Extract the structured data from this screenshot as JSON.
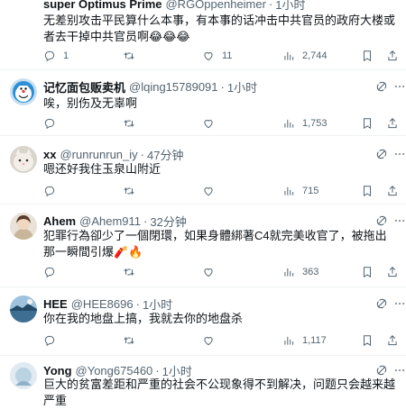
{
  "tweets": [
    {
      "name": "super Optimus Prime",
      "handle": "@RGOppenheimer",
      "time": "1小时",
      "text": "无差别攻击平民算什么本事，有本事的话冲击中共官员的政府大楼或者去干掉中共官员啊😂😂😂",
      "replies": "1",
      "retweets": "",
      "likes": "11",
      "views": "2,744"
    },
    {
      "name": "记忆面包贩卖机",
      "handle": "@lqing15789091",
      "time": "1小时",
      "text": "唉，别伤及无辜啊",
      "replies": "",
      "retweets": "",
      "likes": "",
      "views": "1,753"
    },
    {
      "name": "xx",
      "handle": "@runrunrun_iy",
      "time": "47分钟",
      "text": "嗯还好我住玉泉山附近",
      "replies": "",
      "retweets": "",
      "likes": "",
      "views": "715"
    },
    {
      "name": "Ahem",
      "handle": "@Ahem911",
      "time": "32分钟",
      "text": "犯罪行為卻少了一個閉環，如果身體綁著C4就完美收官了，被拖出那一瞬間引爆🧨🔥",
      "replies": "",
      "retweets": "",
      "likes": "",
      "views": "363"
    },
    {
      "name": "HEE",
      "handle": "@HEE8696",
      "time": "1小时",
      "text": "你在我的地盘上搞，我就去你的地盘杀",
      "replies": "",
      "retweets": "",
      "likes": "",
      "views": "1,117"
    },
    {
      "name": "Yong",
      "handle": "@Yong675460",
      "time": "1小时",
      "text": "巨大的贫富差距和严重的社会不公现象得不到解决，问题只会越来越严重",
      "replies": "",
      "retweets": "",
      "likes": "",
      "views": ""
    }
  ]
}
